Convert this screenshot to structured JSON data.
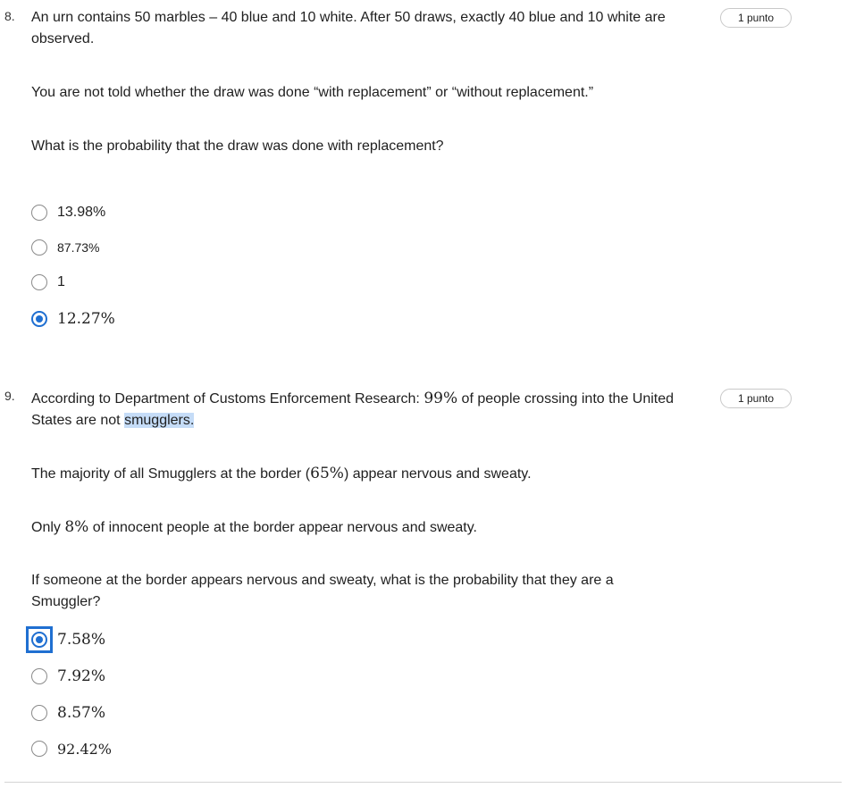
{
  "questions": [
    {
      "number": "8.",
      "points": "1 punto",
      "paragraphs": {
        "p1": "An urn contains 50 marbles – 40 blue and 10 white. After 50 draws, exactly 40 blue and 10 white are observed.",
        "p2": "You are not told whether the draw was done “with replacement” or “without replacement.”",
        "p3": "What is the probability that the draw was done with replacement?"
      },
      "options": [
        {
          "label": "13.98%",
          "selected": false
        },
        {
          "label": "87.73%",
          "selected": false
        },
        {
          "label": "1",
          "selected": false
        },
        {
          "label": "12.27%",
          "selected": true
        }
      ]
    },
    {
      "number": "9.",
      "points": "1 punto",
      "paragraphs": {
        "p1_a": "According to Department of Customs Enforcement Research: ",
        "p1_math": "99%",
        "p1_b": " of people crossing into the United States are not ",
        "p1_highlight": "smugglers.",
        "p2_a": "The majority of all Smugglers at the border (",
        "p2_math": "65%",
        "p2_b": ") appear nervous and sweaty.",
        "p3_a": "Only ",
        "p3_math": "8%",
        "p3_b": " of innocent people at the border appear nervous and sweaty.",
        "p4": "If someone at the border appears nervous and sweaty, what is the probability that they are a Smuggler?"
      },
      "options": [
        {
          "label": "7.58%",
          "selected": true,
          "focused": true
        },
        {
          "label": "7.92%",
          "selected": false
        },
        {
          "label": "8.57%",
          "selected": false
        },
        {
          "label": "92.42%",
          "selected": false
        }
      ]
    }
  ],
  "colors": {
    "accent": "#1f6fd1",
    "highlight": "#c5dcf7",
    "text": "#1f1f1f"
  }
}
